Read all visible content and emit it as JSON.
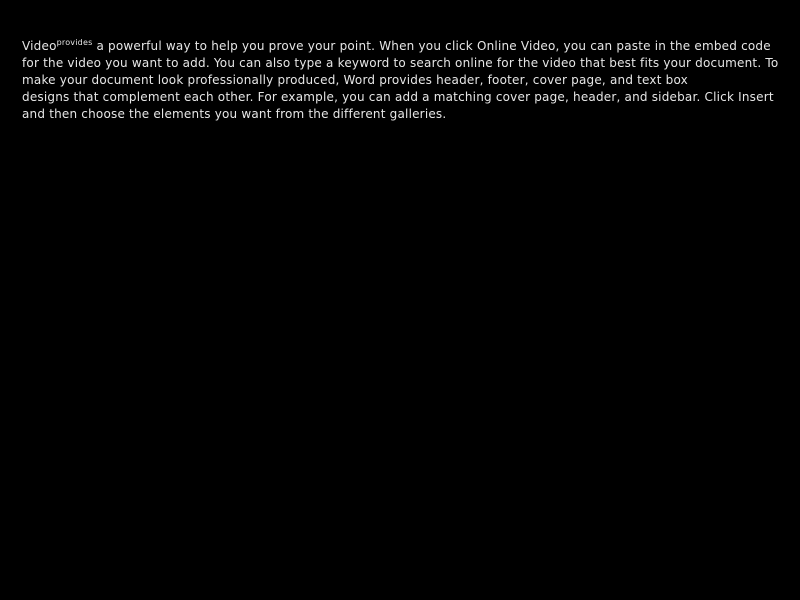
{
  "overlay": {
    "lines": [
      {
        "lead": "Video",
        "sup": "provides",
        "rest": " a powerful way to help you prove your point. When you click Online Video, you can paste in the embed code"
      },
      {
        "lead": "",
        "sup": "",
        "rest": "for the video you want to add. You can also type a keyword to search online for the video that best fits your document. To"
      },
      {
        "lead": "",
        "sup": "",
        "rest": "make your document look professionally produced, Word provides header, footer, cover page, and text box"
      },
      {
        "lead": "",
        "sup": "",
        "rest": "designs that complement each other. For example, you can add a matching cover page, header, and sidebar. Click Insert"
      },
      {
        "lead": "",
        "sup": "",
        "rest": "and then choose the elements you want from the different galleries."
      }
    ]
  },
  "colors": {
    "background": "#000000",
    "text": "#e6e6e6"
  }
}
